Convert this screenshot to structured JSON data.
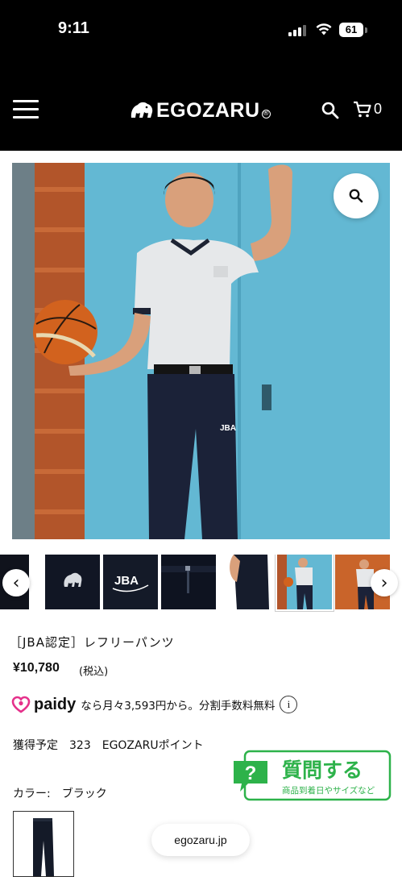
{
  "status_bar": {
    "time": "9:11",
    "battery": "61"
  },
  "header": {
    "logo_text": "EGOZARU",
    "logo_registered": "®",
    "cart_count": "0",
    "icons": [
      "menu-icon",
      "search-icon",
      "cart-icon"
    ]
  },
  "gallery": {
    "zoom_icon": "magnifier-icon",
    "prev_icon": "‹",
    "next_icon": "›",
    "thumb_jba_text": "JBA",
    "main_pants_logo": "JBA"
  },
  "product": {
    "title": "［JBA認定］レフリーパンツ",
    "price": "¥10,780",
    "tax_note": "(税込)",
    "paidy_brand": "paidy",
    "paidy_text": "なら月々3,593円から。分割手数料無料",
    "info_icon": "i",
    "points_text": "獲得予定　323　EGOZARUポイント",
    "color_label": "カラー:　ブラック"
  },
  "qa_badge": {
    "mark": "?",
    "title": "質問する",
    "subtitle": "商品到着日やサイズなど",
    "accent": "#2db24a"
  },
  "url_pill": {
    "text": "egozaru.jp"
  },
  "colors": {
    "header_bg": "#000000",
    "paidy_pink": "#e5318b",
    "background": "#ffffff"
  }
}
